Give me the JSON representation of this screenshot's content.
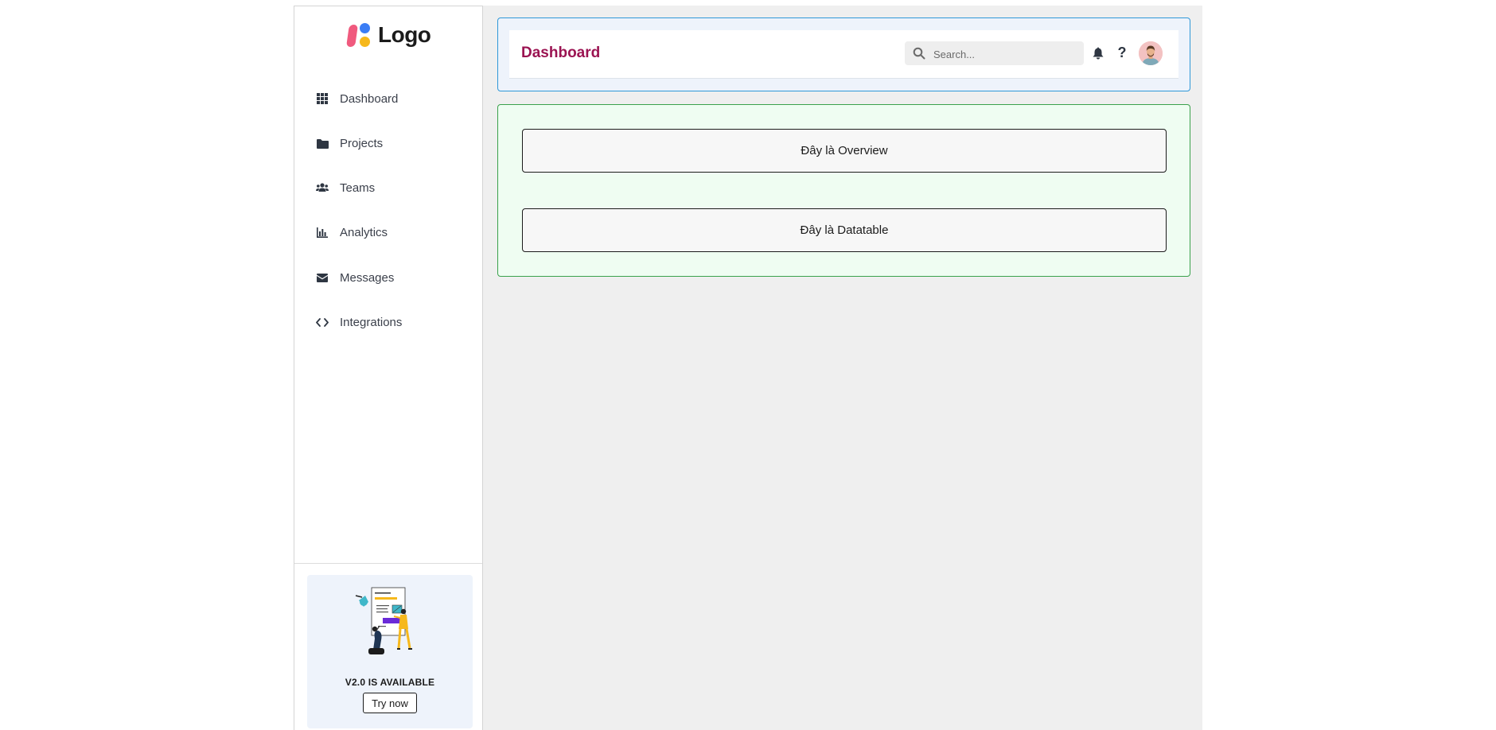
{
  "logo": {
    "text": "Logo"
  },
  "sidebar": {
    "items": [
      {
        "label": "Dashboard",
        "icon": "grid-icon"
      },
      {
        "label": "Projects",
        "icon": "folder-icon"
      },
      {
        "label": "Teams",
        "icon": "users-icon"
      },
      {
        "label": "Analytics",
        "icon": "bar-chart-icon"
      },
      {
        "label": "Messages",
        "icon": "envelope-icon"
      },
      {
        "label": "Integrations",
        "icon": "code-icon"
      }
    ],
    "promo": {
      "title": "V2.0 IS AVAILABLE",
      "button_label": "Try now"
    }
  },
  "header": {
    "title": "Dashboard",
    "search_placeholder": "Search...",
    "icons": [
      "bell-icon",
      "question-icon",
      "avatar"
    ]
  },
  "main": {
    "overview_text": "Đây là Overview",
    "datatable_text": "Đây là Datatable"
  },
  "colors": {
    "title_accent": "#9b1452",
    "header_frame_border": "#2f98d8",
    "content_frame_border": "#3aa14c",
    "content_frame_bg": "#effdf2",
    "page_bg": "#efefef"
  }
}
